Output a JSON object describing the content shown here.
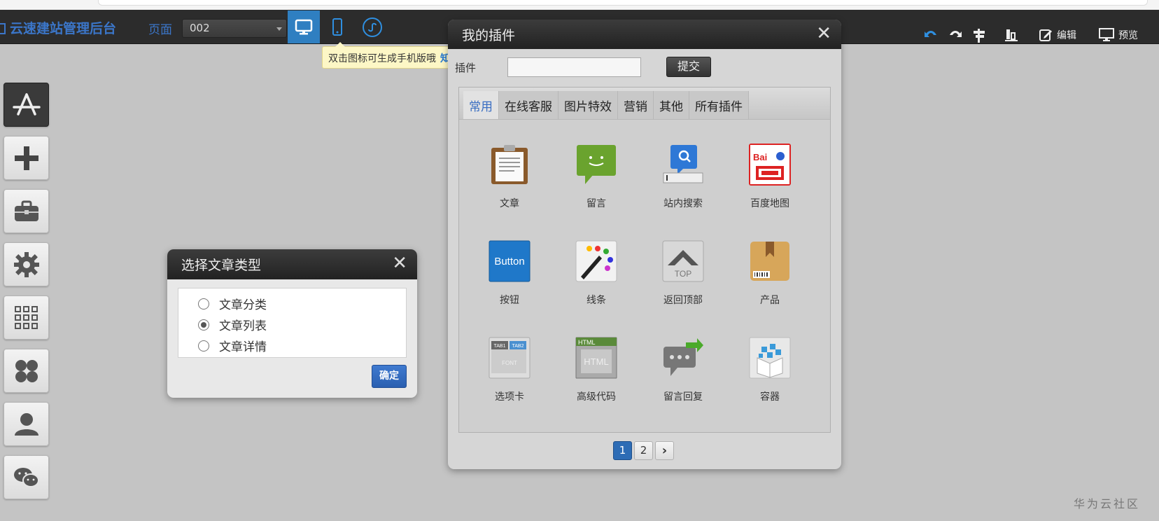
{
  "header": {
    "brand": "云速建站管理后台",
    "page_label": "页面",
    "page_select_value": "002",
    "tools": {
      "edit_label": "编辑",
      "preview_label": "预览"
    }
  },
  "tooltip": {
    "text": "双击图标可生成手机版哦",
    "link": "知道了"
  },
  "left_rail": [
    {
      "name": "app-store-icon"
    },
    {
      "name": "plus-icon"
    },
    {
      "name": "toolbox-icon"
    },
    {
      "name": "gear-icon"
    },
    {
      "name": "grid-icon"
    },
    {
      "name": "clover-icon"
    },
    {
      "name": "user-icon"
    },
    {
      "name": "wechat-icon"
    }
  ],
  "plugin_panel": {
    "title": "我的插件",
    "search_label": "插件",
    "search_value": "",
    "submit_label": "提交",
    "tabs": [
      "常用",
      "在线客服",
      "图片特效",
      "营销",
      "其他",
      "所有插件"
    ],
    "active_tab": 0,
    "items": [
      {
        "label": "文章",
        "icon": "clipboard-icon"
      },
      {
        "label": "留言",
        "icon": "speech-bubble-icon"
      },
      {
        "label": "站内搜索",
        "icon": "search-icon"
      },
      {
        "label": "百度地图",
        "icon": "baidu-map-icon"
      },
      {
        "label": "按钮",
        "icon": "button-icon"
      },
      {
        "label": "线条",
        "icon": "paint-brush-icon"
      },
      {
        "label": "返回顶部",
        "icon": "back-to-top-icon"
      },
      {
        "label": "产品",
        "icon": "product-box-icon"
      },
      {
        "label": "选项卡",
        "icon": "tab-icon"
      },
      {
        "label": "高级代码",
        "icon": "html-code-icon"
      },
      {
        "label": "留言回复",
        "icon": "reply-bubble-icon"
      },
      {
        "label": "容器",
        "icon": "container-box-icon"
      }
    ],
    "pagination": {
      "pages": [
        "1",
        "2"
      ],
      "current": 1,
      "next": "›"
    }
  },
  "article_dialog": {
    "title": "选择文章类型",
    "options": [
      "文章分类",
      "文章列表",
      "文章详情"
    ],
    "selected": 1,
    "confirm_label": "确定"
  },
  "watermark": "华为云社区",
  "colors": {
    "accent": "#3b76c9",
    "header_bg": "#2c2c2c",
    "canvas_bg": "#c4c4c4",
    "primary_button": "#2d6cb5"
  }
}
